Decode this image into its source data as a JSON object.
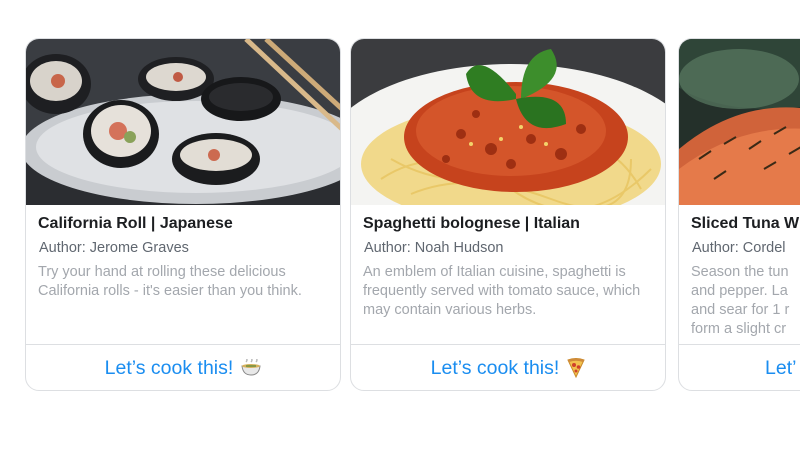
{
  "cards": [
    {
      "title": "California Roll | Japanese",
      "author": "Author: Jerome Graves",
      "description": "Try your hand at rolling these delicious California rolls - it's easier than you think.",
      "button_label": "Let’s cook this!",
      "button_icon": "bowl-icon"
    },
    {
      "title": "Spaghetti bolognese | Italian",
      "author": "Author: Noah Hudson",
      "description": "An emblem of Italian cuisine, spaghetti is frequently served with tomato sauce, which may contain various herbs.",
      "button_label": "Let’s cook this!",
      "button_icon": "pizza-icon"
    },
    {
      "title": "Sliced Tuna W",
      "author": "Author: Cordel",
      "description": "Season the tun\nand pepper. La\nand sear for 1 r\nform a slight cr",
      "button_label": "Let’"
    }
  ]
}
